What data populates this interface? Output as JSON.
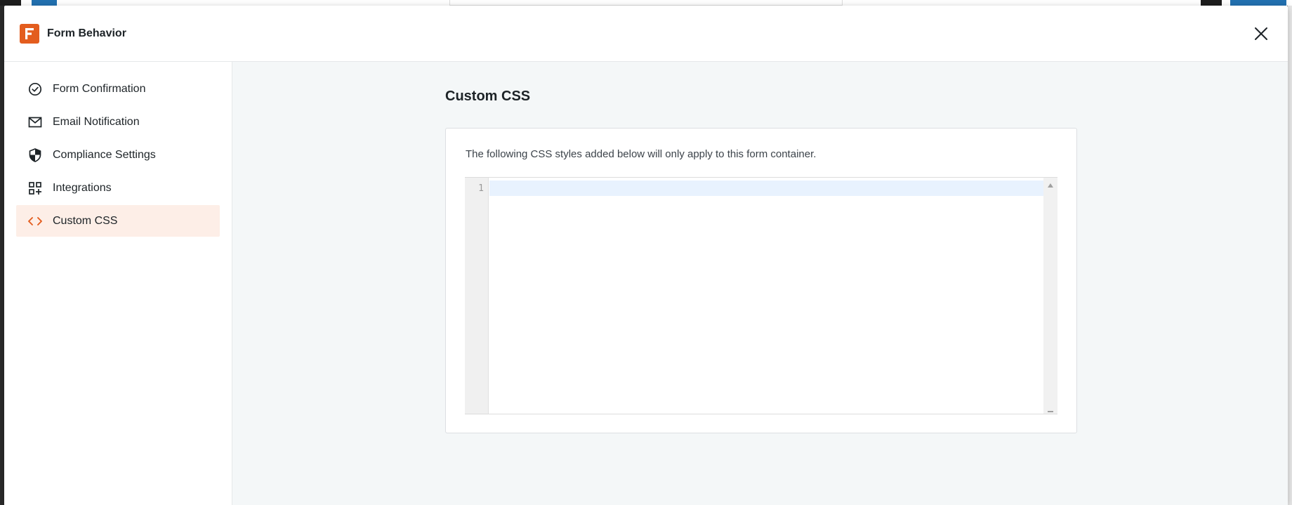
{
  "modal": {
    "title": "Form Behavior",
    "close_icon": "close-icon",
    "logo_icon": "forminator-logo-icon"
  },
  "sidebar": {
    "items": [
      {
        "label": "Form Confirmation",
        "icon": "check-circle-icon",
        "active": false
      },
      {
        "label": "Email Notification",
        "icon": "envelope-icon",
        "active": false
      },
      {
        "label": "Compliance Settings",
        "icon": "shield-icon",
        "active": false
      },
      {
        "label": "Integrations",
        "icon": "grid-plus-icon",
        "active": false
      },
      {
        "label": "Custom CSS",
        "icon": "code-icon",
        "active": true
      }
    ]
  },
  "main": {
    "title": "Custom CSS",
    "description": "The following CSS styles added below will only apply to this form container.",
    "editor": {
      "line_numbers": [
        "1"
      ],
      "value": ""
    }
  },
  "colors": {
    "accent": "#e35d1e",
    "active_bg": "#fdeee7",
    "main_bg": "#f4f7f8"
  }
}
